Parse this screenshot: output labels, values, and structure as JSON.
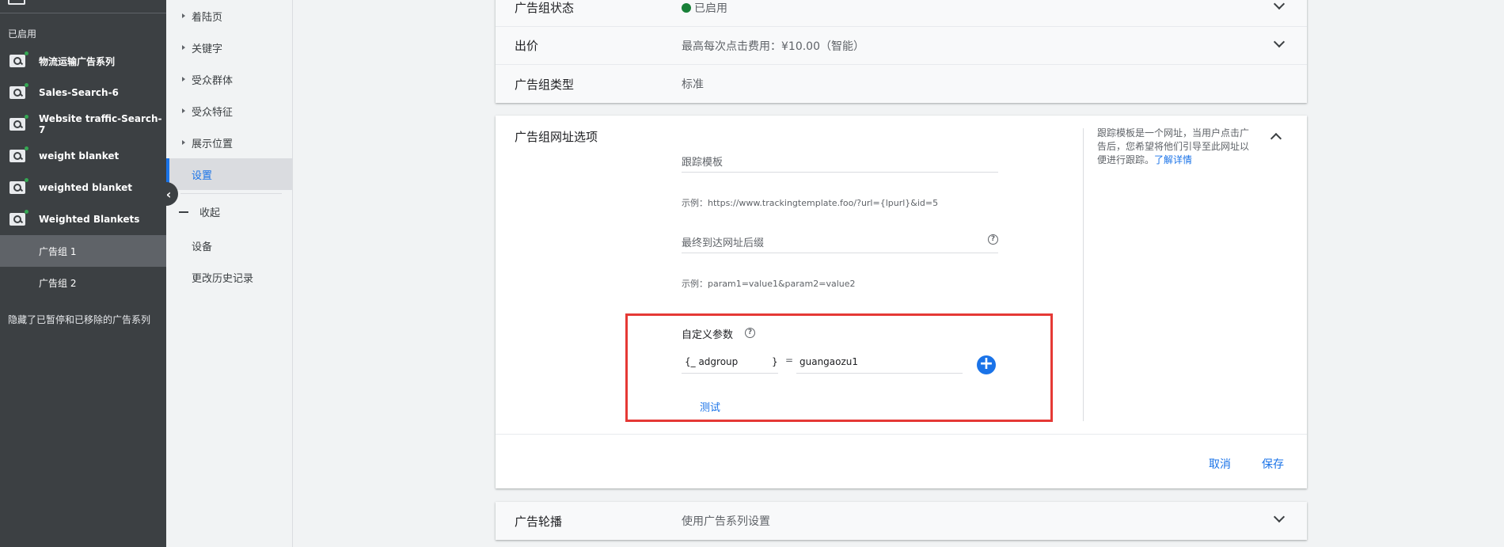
{
  "sidebar": {
    "section_label": "已启用",
    "campaigns": [
      {
        "label": "物流运输广告系列"
      },
      {
        "label": "Sales-Search-6"
      },
      {
        "label": "Website traffic-Search-7"
      },
      {
        "label": "weight blanket"
      },
      {
        "label": "weighted blanket"
      },
      {
        "label": "Weighted Blankets"
      }
    ],
    "ad_groups": [
      {
        "label": "广告组 1"
      },
      {
        "label": "广告组 2"
      }
    ],
    "hidden_note": "隐藏了已暂停和已移除的广告系列"
  },
  "subnav": {
    "items": [
      {
        "label": "着陆页"
      },
      {
        "label": "关键字"
      },
      {
        "label": "受众群体"
      },
      {
        "label": "受众特征"
      },
      {
        "label": "展示位置"
      }
    ],
    "active": "设置",
    "collapse": "收起",
    "extra": [
      "设备",
      "更改历史记录"
    ]
  },
  "settings": {
    "status": {
      "label": "广告组状态",
      "value": "已启用"
    },
    "bid": {
      "label": "出价",
      "value": "最高每次点击费用：¥10.00（智能）"
    },
    "type": {
      "label": "广告组类型",
      "value": "标准"
    },
    "url_options": {
      "title": "广告组网址选项",
      "tracking_template_placeholder": "跟踪模板",
      "tracking_example": "示例：https://www.trackingtemplate.foo/?url={lpurl}&id=5",
      "final_url_suffix_placeholder": "最终到达网址后缀",
      "suffix_example": "示例：param1=value1&param2=value2",
      "custom_params_label": "自定义参数",
      "custom_param_key": "{_ adgroup",
      "custom_param_close": "}",
      "custom_param_equals": "=",
      "custom_param_value": "guangaozu1",
      "test_label": "测试",
      "help_text": "跟踪模板是一个网址，当用户点击广告后，您希望将他们引导至此网址以便进行跟踪。",
      "help_link": "了解详情",
      "cancel_label": "取消",
      "save_label": "保存"
    },
    "rotation": {
      "label": "广告轮播",
      "value": "使用广告系列设置"
    }
  }
}
